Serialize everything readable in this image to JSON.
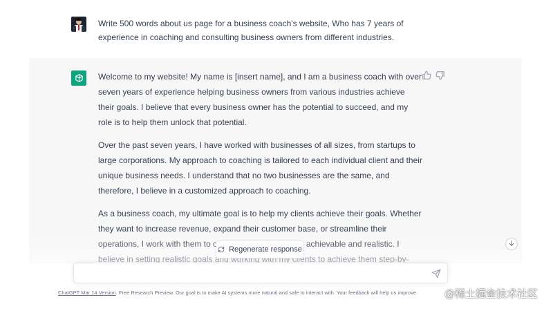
{
  "user_message": {
    "text": "Write 500 words about us page for a business coach's website, Who has 7 years of experience in coaching and consulting business owners from different industries."
  },
  "assistant_message": {
    "paragraphs": [
      "Welcome to my website! My name is [insert name], and I am a business coach with over seven years of experience helping business owners from various industries achieve their goals. I believe that every business owner has the potential to succeed, and my role is to help them unlock that potential.",
      "Over the past seven years, I have worked with businesses of all sizes, from startups to large corporations. My approach to coaching is tailored to each individual client and their unique business needs. I understand that no two businesses are the same, and therefore, I believe in a customized approach to coaching.",
      "As a business coach, my ultimate goal is to help my clients achieve their goals. Whether they want to increase revenue, expand their customer base, or streamline their operations, I work with them to create a plan that is both achievable and realistic. I believe in setting realistic goals and working with my clients to achieve them step-by-step"
    ]
  },
  "controls": {
    "regenerate_label": "Regenerate response",
    "input_placeholder": ""
  },
  "footer": {
    "version_link": "ChatGPT Mar 14 Version",
    "notice": ". Free Research Preview. Our goal is to make AI systems more natural and safe to interact with. Your feedback will help us improve."
  },
  "watermark": {
    "text": "@稀土掘金技术社区"
  },
  "colors": {
    "brand_green": "#10a37f",
    "assistant_bg": "#f7f7f8"
  },
  "icons": [
    "user-avatar",
    "openai-logo-icon",
    "thumbs-up-icon",
    "thumbs-down-icon",
    "regenerate-icon",
    "scroll-down-icon",
    "send-icon"
  ]
}
